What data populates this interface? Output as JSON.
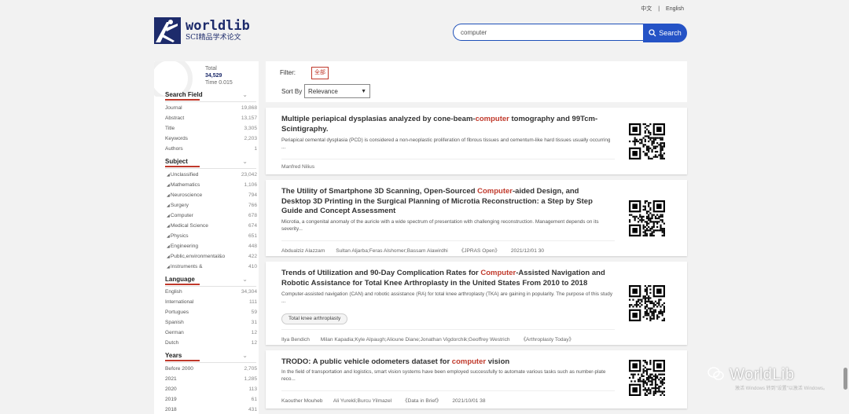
{
  "header": {
    "logo_title": "worldlib",
    "logo_sub": "SCI精品学术论文",
    "lang_cn": "中文",
    "lang_sep": "|",
    "lang_en": "English",
    "search_value": "computer",
    "search_button": "Search"
  },
  "sidebar": {
    "total_label": "Total",
    "total_value": "34,529",
    "time_label": "Time 0.015",
    "search_field": {
      "title": "Search Field",
      "items": [
        {
          "label": "Journal",
          "count": "19,868"
        },
        {
          "label": "Abstract",
          "count": "13,157"
        },
        {
          "label": "Title",
          "count": "3,305"
        },
        {
          "label": "Keywords",
          "count": "2,203"
        },
        {
          "label": "Authors",
          "count": "1"
        }
      ]
    },
    "subject": {
      "title": "Subject",
      "items": [
        {
          "label": "Unclassified",
          "count": "23,042"
        },
        {
          "label": "Mathematics",
          "count": "1,106"
        },
        {
          "label": "Neuroscience",
          "count": "794"
        },
        {
          "label": "Surgery",
          "count": "766"
        },
        {
          "label": "Computer",
          "count": "678"
        },
        {
          "label": "Medical Science",
          "count": "674"
        },
        {
          "label": "Physics",
          "count": "651"
        },
        {
          "label": "Engineering",
          "count": "448"
        },
        {
          "label": "Public,environmental&o",
          "count": "422"
        },
        {
          "label": "Instruments &",
          "count": "410"
        }
      ]
    },
    "language": {
      "title": "Language",
      "items": [
        {
          "label": "English",
          "count": "34,304"
        },
        {
          "label": "International",
          "count": "111"
        },
        {
          "label": "Portugues",
          "count": "59"
        },
        {
          "label": "Spanish",
          "count": "31"
        },
        {
          "label": "German",
          "count": "12"
        },
        {
          "label": "Dutch",
          "count": "12"
        }
      ]
    },
    "years": {
      "title": "Years",
      "items": [
        {
          "label": "Before 2000",
          "count": "2,705"
        },
        {
          "label": "2021",
          "count": "1,285"
        },
        {
          "label": "2020",
          "count": "113"
        },
        {
          "label": "2019",
          "count": "61"
        },
        {
          "label": "2018",
          "count": "431"
        }
      ]
    }
  },
  "filter": {
    "label": "Filter:",
    "badge": "全部",
    "sort_label": "Sort By",
    "sort_value": "Relevance"
  },
  "results": [
    {
      "title_pre": "Multiple periapical dysplasias analyzed by cone-beam-",
      "title_hl": "computer",
      "title_post": " tomography and 99Tcm-Scintigraphy.",
      "abstract": "Periapical cemental dysplasia (PCD) is considered a non-neoplastic proliferation of fibrous tissues and cementum-like hard tissues usually occurring ...",
      "author": "Manfred Nilius"
    },
    {
      "title_pre": "The Utility of Smartphone 3D Scanning, Open-Sourced ",
      "title_hl": "Computer",
      "title_post": "-aided Design, and Desktop 3D Printing in the Surgical Planning of Microtia Reconstruction: a Step by Step Guide and Concept Assessment",
      "abstract": "Microtia, a congenital anomaly of the auricle with a wide spectrum of presentation with challenging reconstruction. Management depends on its severity...",
      "author": "Abdualziz Alazzam",
      "coauthors": "Sultan Aljarba;Feras Alshomer;Bassam Alawirdhi",
      "journal": "《JPRAS Open》",
      "date": "2021/12/01 30"
    },
    {
      "title_pre": "Trends of Utilization and 90-Day Complication Rates for ",
      "title_hl": "Computer",
      "title_post": "-Assisted Navigation and Robotic Assistance for Total Knee Arthroplasty in the United States From 2010 to 2018",
      "abstract": "Computer-assisted navigation (CAN) and robotic assistance (RA) for total knee arthroplasty (TKA) are gaining in popularity. The purpose of this study ...",
      "tag": "Total knee arthroplasty",
      "author": "Ilya Bendich",
      "coauthors": "Milan Kapadia;Kyle Alpaugh;Alioune Diane;Jonathan Vigdorchik;Geoffrey Westrich",
      "journal": "《Arthroplasty Today》"
    },
    {
      "title_pre": "TRODO: A public vehicle odometers dataset for ",
      "title_hl": "computer",
      "title_post": " vision",
      "abstract": "In the field of transportation and logistics, smart vision systems have been employed successfully to automate various tasks such as number-plate reco...",
      "author": "Kaouther Mouheb",
      "coauthors": "Ali Yurekli;Burcu Yilmazel",
      "journal": "《Data in Brief》",
      "date": "2021/10/01 38"
    }
  ],
  "watermark": {
    "text": "WorldLib",
    "sub": "激活 Windows 转到\"设置\"以激活 Windows。"
  }
}
